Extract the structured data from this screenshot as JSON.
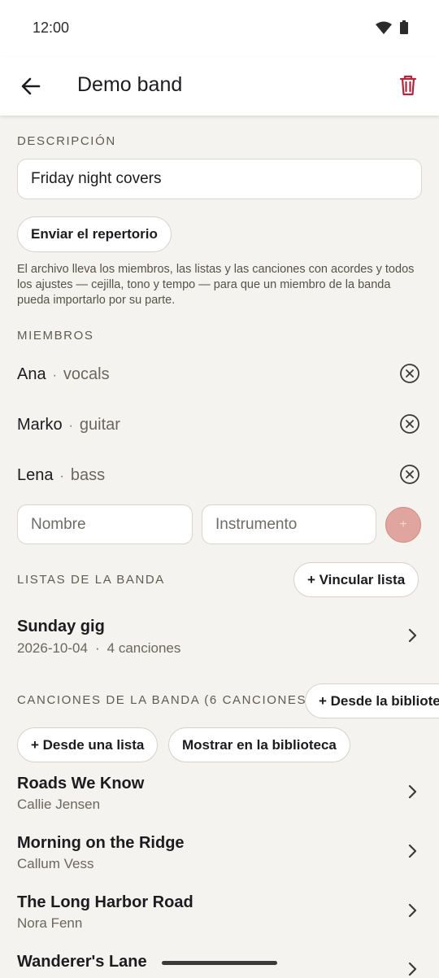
{
  "status_bar": {
    "time": "12:00"
  },
  "app_bar": {
    "title": "Demo band"
  },
  "description": {
    "label": "DESCRIPCIÓN",
    "value": "Friday night covers",
    "send_button": "Enviar el repertorio",
    "helper": "El archivo lleva los miembros, las listas y las canciones con acordes y todos los ajustes — cejilla, tono y tempo — para que un miembro de la banda pueda importarlo por su parte."
  },
  "members": {
    "label": "MIEMBROS",
    "separator": "·",
    "items": [
      {
        "name": "Ana",
        "instrument": "vocals"
      },
      {
        "name": "Marko",
        "instrument": "guitar"
      },
      {
        "name": "Lena",
        "instrument": "bass"
      }
    ],
    "name_placeholder": "Nombre",
    "instrument_placeholder": "Instrumento",
    "add_label": "+"
  },
  "lists": {
    "label": "LISTAS DE LA BANDA",
    "link_button": "+ Vincular lista",
    "items": [
      {
        "title": "Sunday gig",
        "date": "2026-10-04",
        "separator": "·",
        "count": "4 canciones"
      }
    ]
  },
  "songs": {
    "label": "CANCIONES DE LA BANDA (6 CANCIONES)",
    "from_library_button": "+ Desde la bibliote",
    "from_list_button": "+ Desde una lista",
    "show_library_button": "Mostrar en la biblioteca",
    "items": [
      {
        "title": "Roads We Know",
        "artist": "Callie Jensen"
      },
      {
        "title": "Morning on the Ridge",
        "artist": "Callum Vess"
      },
      {
        "title": "The Long Harbor Road",
        "artist": "Nora Fenn"
      },
      {
        "title": "Wanderer's Lane",
        "artist": ""
      }
    ]
  },
  "colors": {
    "accent": "#b3263e",
    "background": "#f5f3ef",
    "add_button": "#e0a59e"
  }
}
